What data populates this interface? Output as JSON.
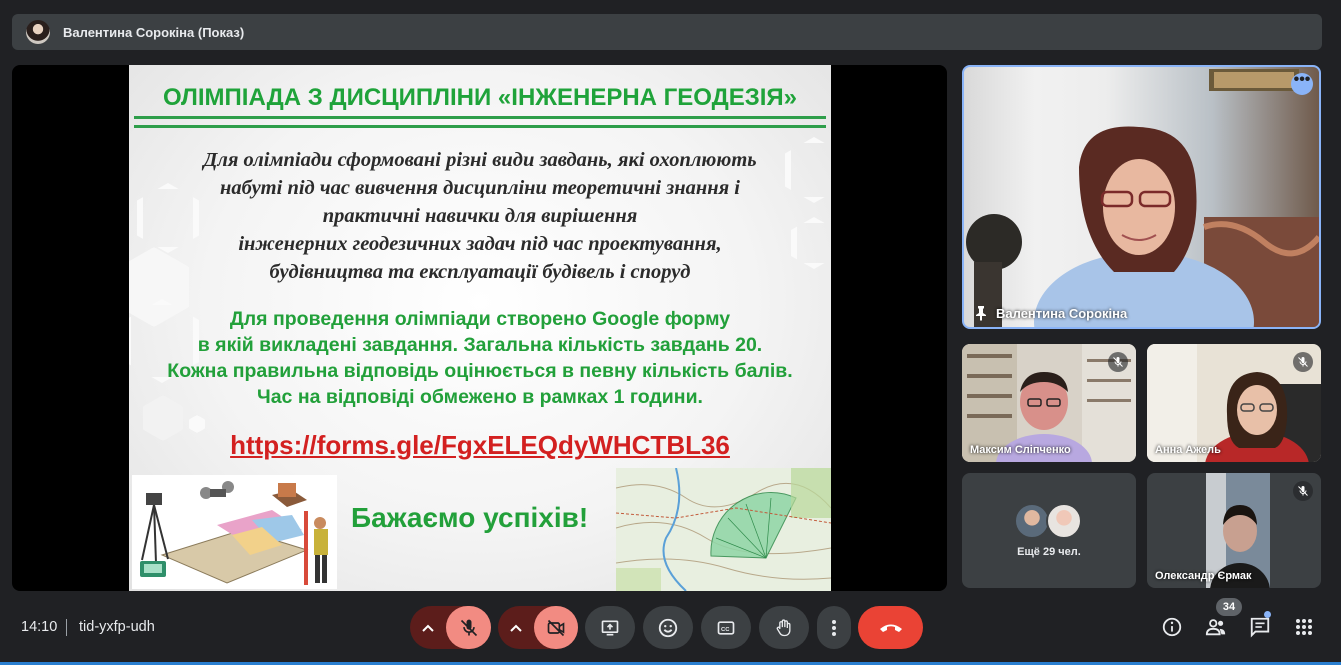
{
  "presenter_bar": {
    "title": "Валентина Сорокіна (Показ)"
  },
  "slide": {
    "title": "ОЛІМПІАДА З ДИСЦИПЛІНИ «ІНЖЕНЕРНА ГЕОДЕЗІЯ»",
    "paragraph1": [
      "Для олімпіади сформовані різні види завдань, які охоплюють",
      "набуті під час вивчення дисципліни теоретичні знання і",
      "практичні навички для вирішення",
      "інженерних геодезичних задач під час проектування,",
      "будівництва та експлуатації будівель і споруд"
    ],
    "paragraph2": [
      "Для проведення олімпіади створено Google форму",
      "в якій викладені завдання. Загальна кількість завдань 20.",
      "Кожна правильна відповідь оцінюється в певну кількість балів.",
      "Час на відповіді обмежено в рамках 1 години."
    ],
    "link": "https://forms.gle/FgxELEQdyWHCTBL36",
    "wish": "Бажаємо успіхів!"
  },
  "participants": {
    "main": {
      "name": "Валентина Сорокіна",
      "pinned": true
    },
    "tile1": {
      "name": "Максим Сліпченко",
      "muted": true
    },
    "tile2": {
      "name": "Анна Ажель",
      "muted": true
    },
    "others": {
      "label": "Ещё 29 чел."
    },
    "tile3": {
      "name": "Олександр Єрмак",
      "muted": true
    }
  },
  "footer": {
    "time": "14:10",
    "meeting_code": "tid-yxfp-udh",
    "people_count": "34"
  },
  "colors": {
    "slide_green": "#22a03a",
    "link_red": "#d32020",
    "end_call": "#ea4335",
    "muted_control": "#f28b82",
    "active_border": "#8ab4f8"
  },
  "icons": [
    "user-avatar",
    "pin-icon",
    "more-icon",
    "mic-off-icon",
    "chevron-up-icon",
    "camera-off-icon",
    "present-screen-icon",
    "emoji-icon",
    "captions-icon",
    "raise-hand-icon",
    "more-vert-icon",
    "end-call-icon",
    "info-icon",
    "people-icon",
    "chat-icon",
    "apps-icon"
  ]
}
